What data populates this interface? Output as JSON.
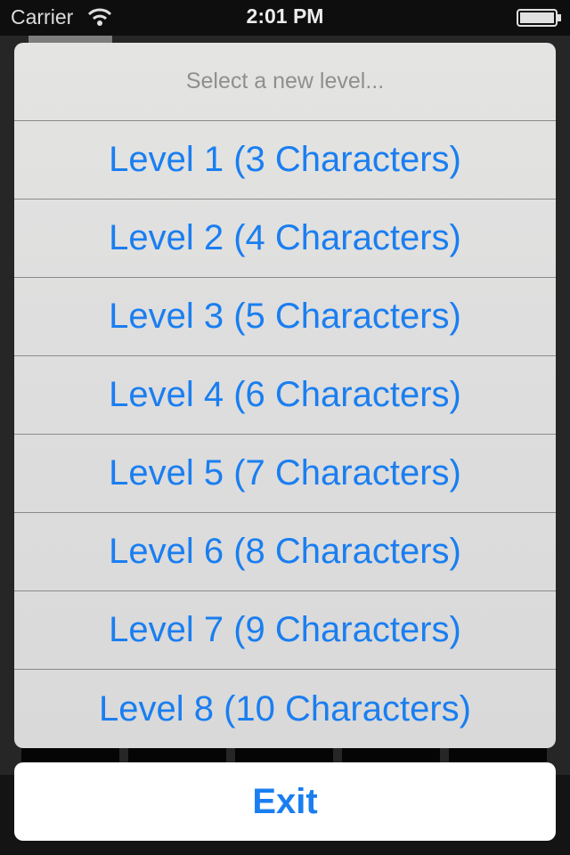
{
  "status_bar": {
    "carrier": "Carrier",
    "time": "2:01 PM",
    "wifi_icon": "wifi-icon",
    "battery_icon": "battery-icon"
  },
  "action_sheet": {
    "title": "Select a new level...",
    "items": [
      {
        "label": "Level 1 (3 Characters)"
      },
      {
        "label": "Level 2 (4 Characters)"
      },
      {
        "label": "Level 3 (5 Characters)"
      },
      {
        "label": "Level 4 (6 Characters)"
      },
      {
        "label": "Level 5 (7 Characters)"
      },
      {
        "label": "Level 6 (8 Characters)"
      },
      {
        "label": "Level 7 (9 Characters)"
      },
      {
        "label": "Level 8 (10 Characters)"
      }
    ],
    "cancel_label": "Exit"
  },
  "colors": {
    "accent": "#1a7ef0",
    "title_text": "#8f8f8f",
    "separator": "#8a8a8a"
  }
}
